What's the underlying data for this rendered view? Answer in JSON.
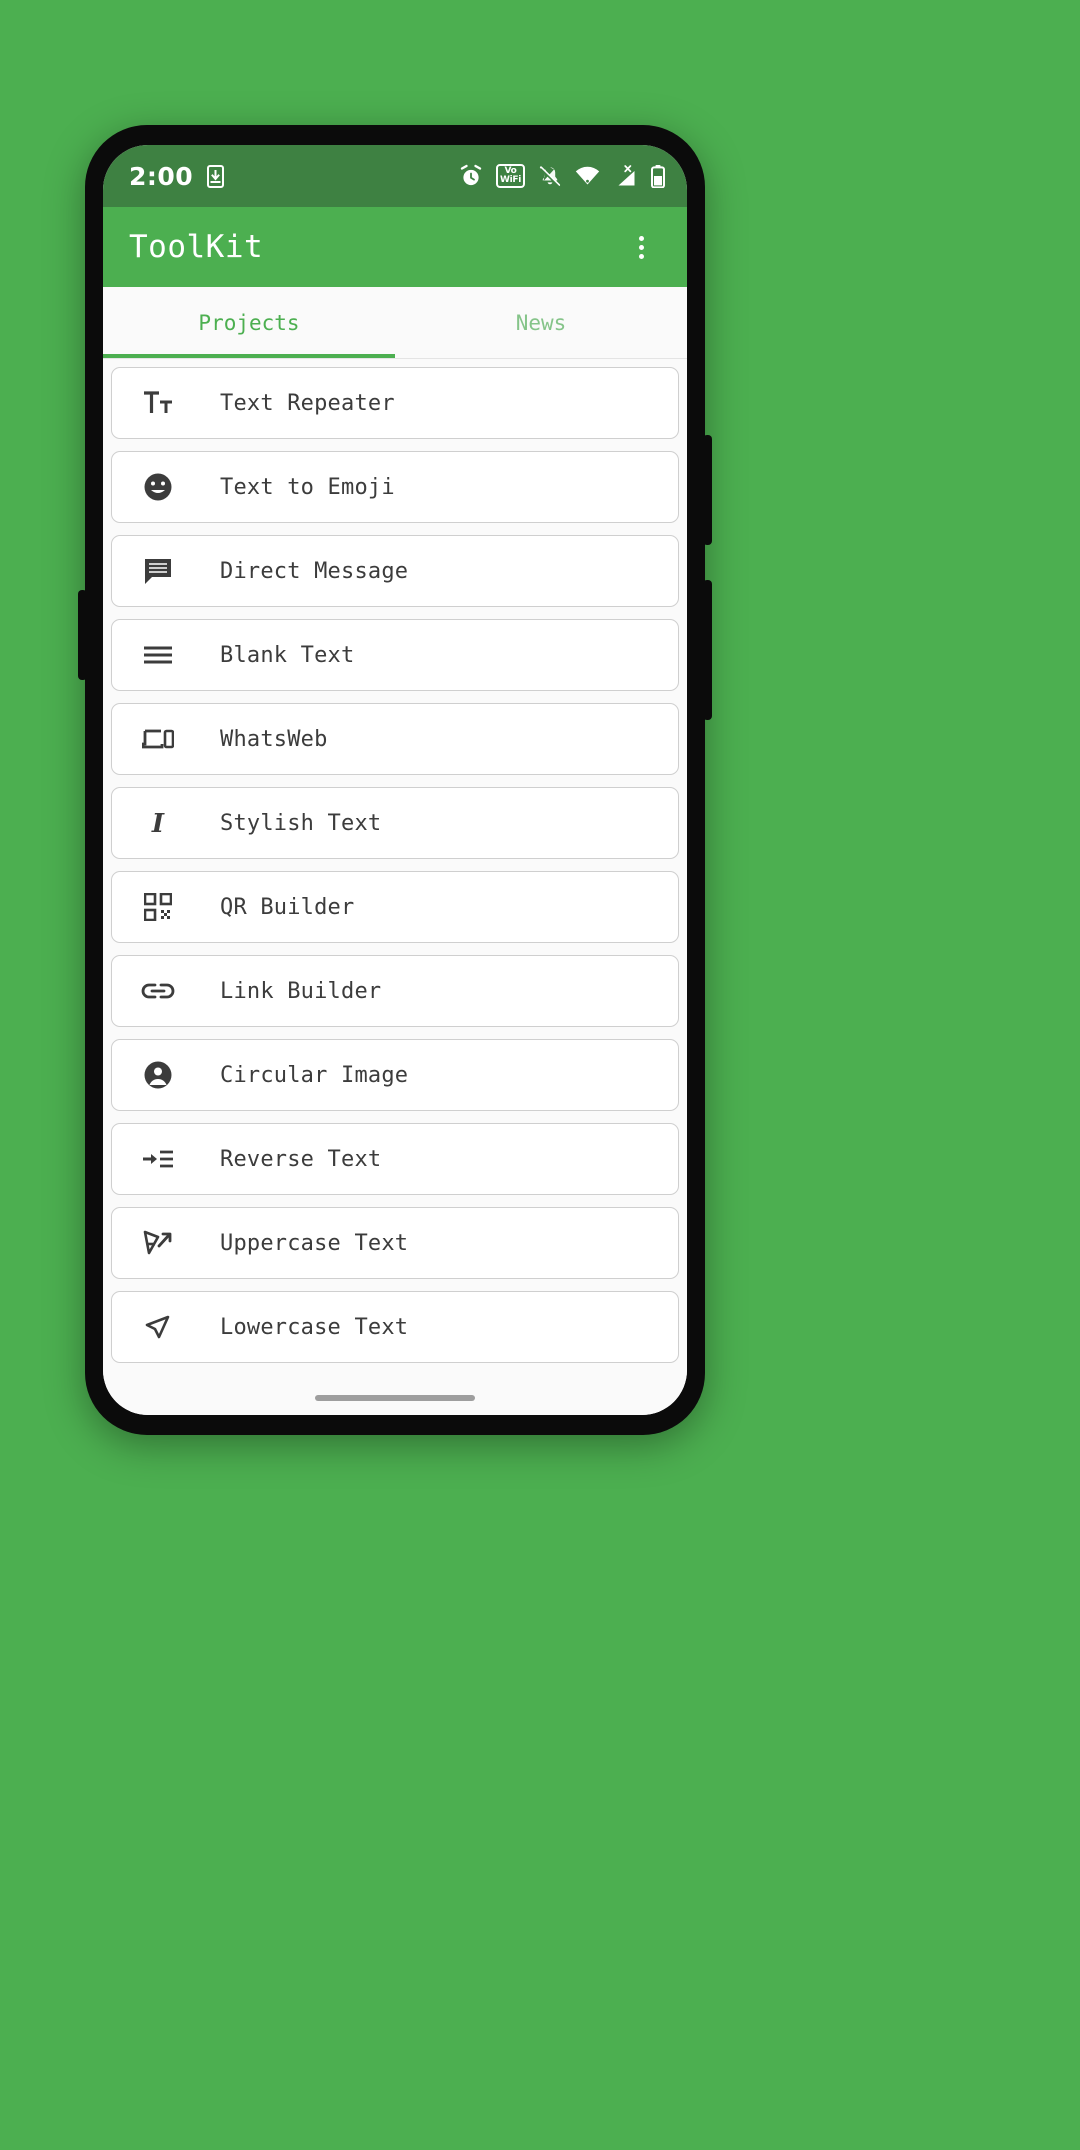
{
  "theme": {
    "background": "#4CAF50",
    "primary": "#4CAF50",
    "status_bar": "#3e8142",
    "surface": "#ffffff",
    "page_bg": "#fafafa",
    "text": "#3c3c3c",
    "tab_inactive": "#85c489"
  },
  "status_bar": {
    "clock": "2:00",
    "left_icons": [
      {
        "name": "phone-download-icon",
        "label": "download to phone"
      }
    ],
    "right_icons": [
      {
        "name": "alarm-clock-icon",
        "label": "alarm set"
      },
      {
        "name": "vowifi-icon",
        "label_top": "Vo",
        "label_bottom": "WiFi"
      },
      {
        "name": "bell-off-icon",
        "label": "silent mode"
      },
      {
        "name": "wifi-icon",
        "label": "wifi connected"
      },
      {
        "name": "signal-no-data-icon",
        "label": "X",
        "sublabel": "mobile signal no data"
      },
      {
        "name": "battery-icon",
        "label": "battery"
      }
    ]
  },
  "app_bar": {
    "title": "ToolKit",
    "overflow_menu": "more options"
  },
  "tabs": [
    {
      "label": "Projects",
      "active": true
    },
    {
      "label": "News",
      "active": false
    }
  ],
  "tool_list": [
    {
      "label": "Text Repeater",
      "icon": "text-format-icon"
    },
    {
      "label": "Text to Emoji",
      "icon": "emoji-face-icon"
    },
    {
      "label": "Direct Message",
      "icon": "chat-bubble-icon"
    },
    {
      "label": "Blank Text",
      "icon": "hamburger-lines-icon"
    },
    {
      "label": "WhatsWeb",
      "icon": "laptop-phone-icon"
    },
    {
      "label": "Stylish Text",
      "icon": "italic-icon"
    },
    {
      "label": "QR Builder",
      "icon": "qr-code-icon"
    },
    {
      "label": "Link Builder",
      "icon": "link-chain-icon"
    },
    {
      "label": "Circular Image",
      "icon": "account-circle-icon"
    },
    {
      "label": "Reverse Text",
      "icon": "format-indent-icon"
    },
    {
      "label": "Uppercase Text",
      "icon": "uppercase-arrow-icon"
    },
    {
      "label": "Lowercase Text",
      "icon": "lowercase-arrow-icon"
    }
  ],
  "navigation": {
    "gesture_pill": "home gesture pill"
  }
}
